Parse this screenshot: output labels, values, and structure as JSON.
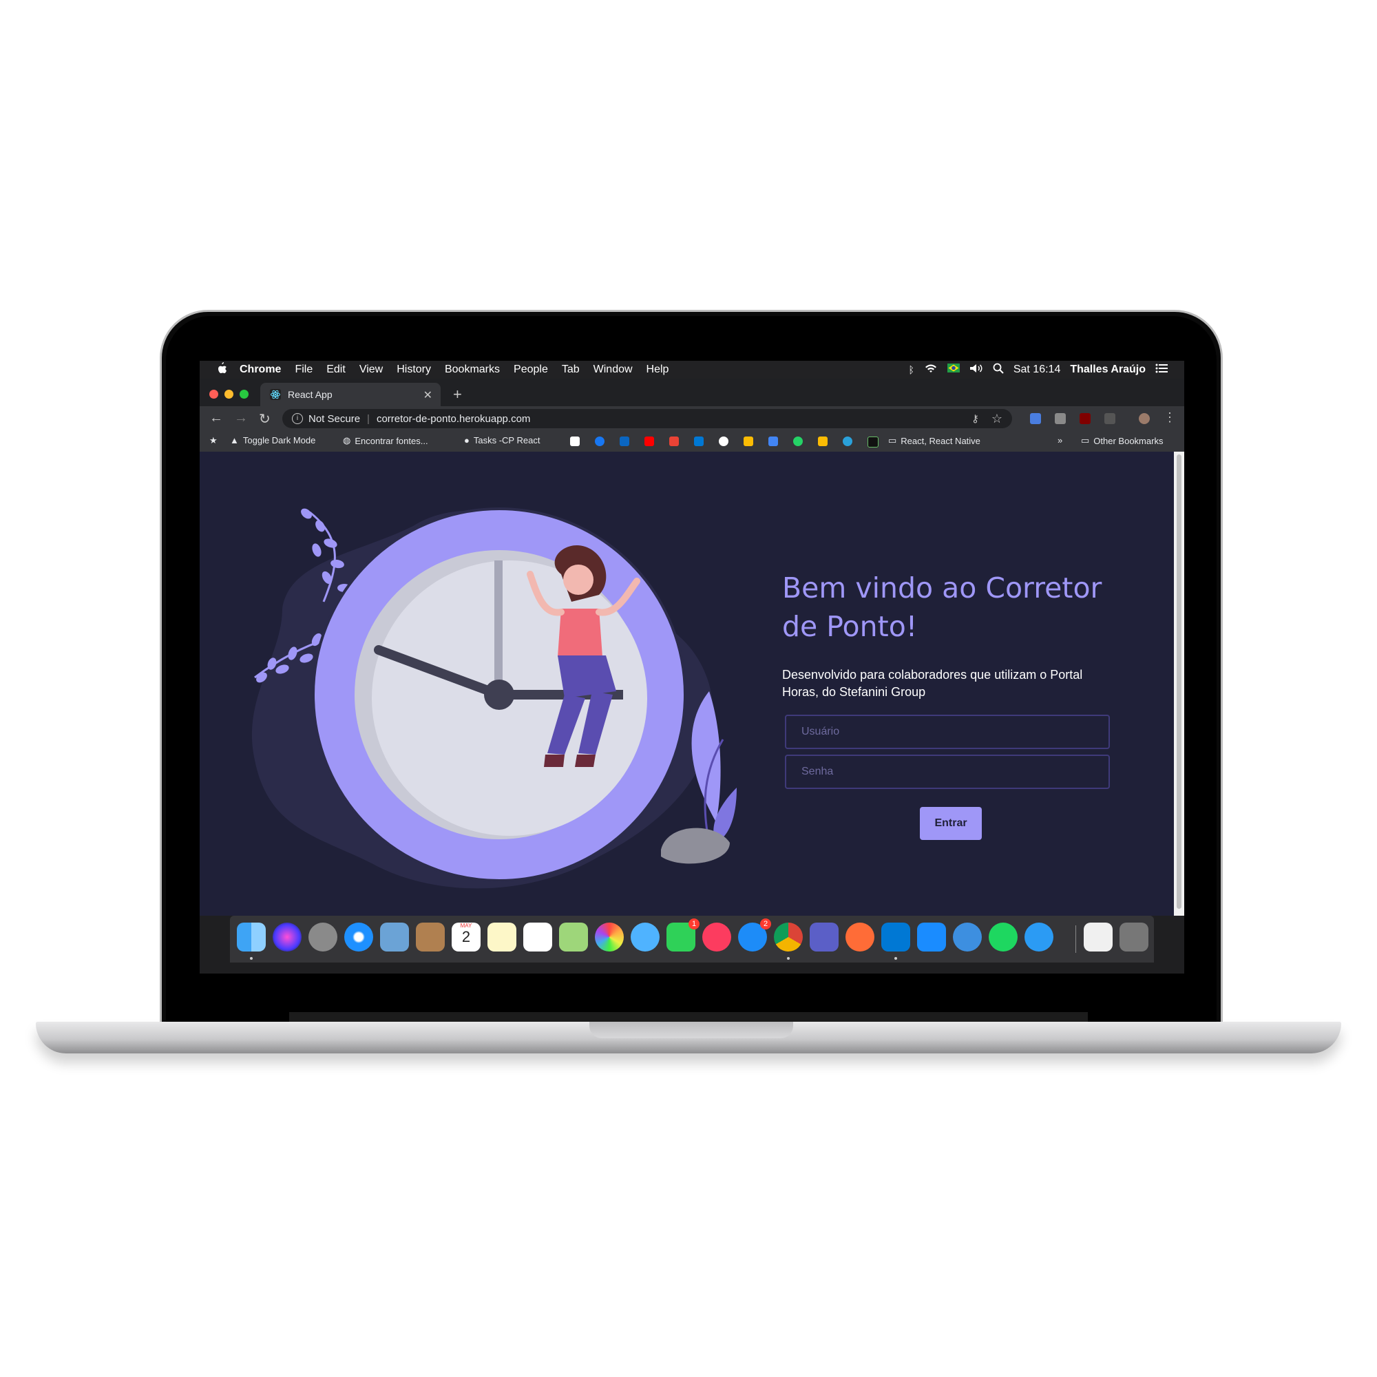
{
  "menubar": {
    "app": "Chrome",
    "items": [
      "File",
      "Edit",
      "View",
      "History",
      "Bookmarks",
      "People",
      "Tab",
      "Window",
      "Help"
    ],
    "clock": "Sat 16:14",
    "user": "Thalles Araújo"
  },
  "tab": {
    "title": "React App"
  },
  "omnibox": {
    "security": "Not Secure",
    "url": "corretor-de-ponto.herokuapp.com"
  },
  "bookmarks": {
    "toggle": "Toggle Dark Mode",
    "fonts": "Encontrar fontes...",
    "tasks": "Tasks -CP React",
    "folder": "React, React Native",
    "more": "»",
    "other": "Other Bookmarks"
  },
  "page": {
    "title": "Bem vindo ao Corretor de Ponto!",
    "subtitle": "Desenvolvido para colaboradores que utilizam o Portal Horas, do Stefanini Group",
    "username_placeholder": "Usuário",
    "password_placeholder": "Senha",
    "submit": "Entrar"
  },
  "dock": {
    "calendar_month": "MAY",
    "calendar_day": "2",
    "badges": {
      "facetime": "1",
      "appstore": "2"
    }
  },
  "colors": {
    "page_bg": "#1f2038",
    "accent": "#9f97f7",
    "clock_face": "#dcdde8",
    "blob": "#2b2b4a"
  }
}
